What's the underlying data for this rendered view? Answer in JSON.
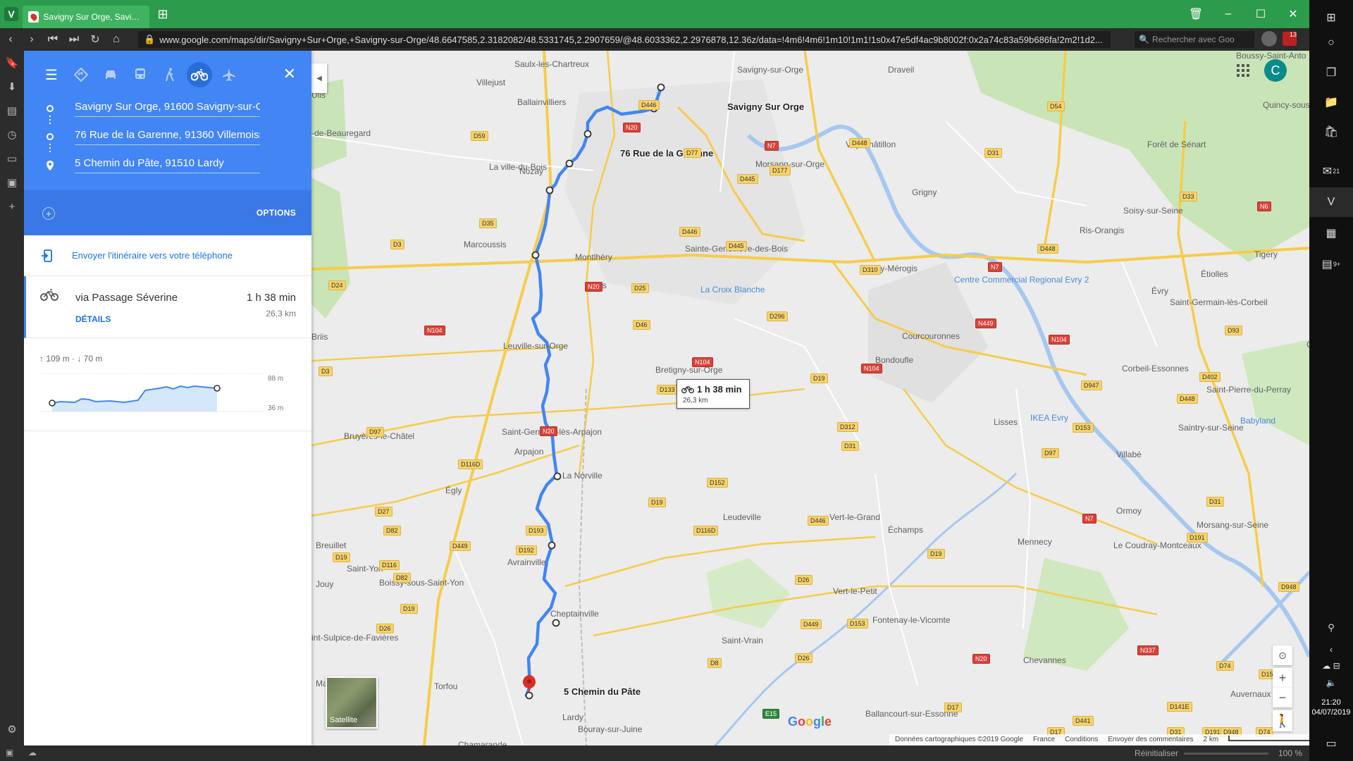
{
  "browser": {
    "tab_title": "Savigny Sur Orge, Savigny-",
    "url": "www.google.com/maps/dir/Savigny+Sur+Orge,+Savigny-sur-Orge/48.6647585,2.3182082/48.5331745,2.2907659/@48.6033362,2.2976878,12.36z/data=!4m6!4m6!1m10!1m1!1s0x47e5df4ac9b8002f:0x2a74c83a59b686fa!2m2!1d2...",
    "search_placeholder": "Rechercher avec Goo",
    "notif_badge": "13",
    "status_reset": "Réinitialiser",
    "status_zoom": "100 %"
  },
  "directions": {
    "waypoints": [
      "Savigny Sur Orge, 91600 Savigny-sur-Orge",
      "76 Rue de la Garenne, 91360 Villemoisson",
      "5 Chemin du Pâte, 91510 Lardy"
    ],
    "options_label": "OPTIONS",
    "send_label": "Envoyer l'itinéraire vers votre téléphone",
    "route": {
      "via": "via Passage Séverine",
      "duration": "1 h 38 min",
      "distance": "26,3 km",
      "details_label": "DÉTAILS"
    },
    "elevation": {
      "stats": "↑ 109 m · ↓ 70 m",
      "high": "88 m",
      "low": "36 m"
    }
  },
  "map": {
    "account_initial": "C",
    "route_label": {
      "duration": "1 h 38 min",
      "distance": "26,3 km"
    },
    "satellite_label": "Satellite",
    "google_logo": "Google",
    "attribution": [
      "Données cartographiques ©2019 Google",
      "France",
      "Conditions",
      "Envoyer des commentaires",
      "2 km"
    ],
    "stop_labels": {
      "start": "Savigny Sur Orge",
      "mid": "76 Rue de la Garenne",
      "end": "5 Chemin du Pâte"
    },
    "places": [
      {
        "t": "Saulx-les-Chartreux"
      },
      {
        "t": "Villejust"
      },
      {
        "t": "Ballainvilliers"
      },
      {
        "t": "Savigny-sur-Orge"
      },
      {
        "t": "Draveil"
      },
      {
        "t": "Boussy-Saint-Anto"
      },
      {
        "t": "Quincy-sous"
      },
      {
        "t": "Forêt de Sénart"
      },
      {
        "t": "Viry-Châtillon"
      },
      {
        "t": "Morsang-sur-Orge"
      },
      {
        "t": "La ville-du-Bois"
      },
      {
        "t": "Nozay"
      },
      {
        "t": "Grigny"
      },
      {
        "t": "Soisy-sur-Seine"
      },
      {
        "t": "Ris-Orangis"
      },
      {
        "t": "Marcoussis"
      },
      {
        "t": "Montlhéry"
      },
      {
        "t": "Sainte-Geneviève-des-Bois"
      },
      {
        "t": "Fleury-Mérogis"
      },
      {
        "t": "Tigery"
      },
      {
        "t": "Linas"
      },
      {
        "t": "La Croix Blanche"
      },
      {
        "t": "Centre Commercial Regional Evry 2"
      },
      {
        "t": "Évry"
      },
      {
        "t": "Étiolles"
      },
      {
        "t": "Saint-Germain-lès-Corbeil"
      },
      {
        "t": "Leuville-sur-Orge"
      },
      {
        "t": "Bretigny-sur-Orge"
      },
      {
        "t": "Courcouronnes"
      },
      {
        "t": "Bondoufle"
      },
      {
        "t": "Carré Séna"
      },
      {
        "t": "Corbeil-Essonnes"
      },
      {
        "t": "Saint-Pierre-du-Perray"
      },
      {
        "t": "Bruyères-le-Châtel"
      },
      {
        "t": "Saint-Germain-lès-Arpajon"
      },
      {
        "t": "Lisses"
      },
      {
        "t": "IKEA Evry"
      },
      {
        "t": "Saintry-sur-Seine"
      },
      {
        "t": "Babyland"
      },
      {
        "t": "Arpajon"
      },
      {
        "t": "La Norville"
      },
      {
        "t": "Villabé"
      },
      {
        "t": "Égly"
      },
      {
        "t": "Leudeville"
      },
      {
        "t": "Vert-le-Grand"
      },
      {
        "t": "Ormoy"
      },
      {
        "t": "Morsang-sur-Seine"
      },
      {
        "t": "Échamps"
      },
      {
        "t": "Breuillet"
      },
      {
        "t": "Mennecy"
      },
      {
        "t": "Le Coudray-Montceaux"
      },
      {
        "t": "Saint-Yon"
      },
      {
        "t": "Avrainville"
      },
      {
        "t": "Boissy-sous-Saint-Yon"
      },
      {
        "t": "Jouy"
      },
      {
        "t": "Vert-le-Petit"
      },
      {
        "t": "Cheptainville"
      },
      {
        "t": "Fontenay-le-Vicomte"
      },
      {
        "t": "Saint-Vrain"
      },
      {
        "t": "int-Sulpice-de-Favières"
      },
      {
        "t": "Chevannes"
      },
      {
        "t": "Mauchamps"
      },
      {
        "t": "Torfou"
      },
      {
        "t": "Auvernaux"
      },
      {
        "t": "Lardy"
      },
      {
        "t": "Bouray-sur-Juine"
      },
      {
        "t": "Ballancourt-sur-Essonne"
      },
      {
        "t": "Chamarande"
      },
      {
        "t": "Ulis"
      },
      {
        "t": "-de-Beauregard"
      },
      {
        "t": "Briis"
      }
    ],
    "roads": [
      "D446",
      "D59",
      "N20",
      "D77",
      "N7",
      "D177",
      "D448",
      "D31",
      "D54",
      "D445",
      "D35",
      "D446",
      "D3",
      "D445",
      "N6",
      "D33",
      "N7",
      "D448",
      "D24",
      "N20",
      "D25",
      "D310",
      "D46",
      "N104",
      "N449",
      "N104",
      "D93",
      "N104",
      "D296",
      "D3",
      "D19",
      "N104",
      "D133",
      "D402",
      "D448",
      "D947",
      "D97",
      "N20",
      "D312",
      "D31",
      "D153",
      "D97",
      "D116D",
      "D152",
      "D31",
      "D19",
      "D116D",
      "D446",
      "D27",
      "D82",
      "D193",
      "D449",
      "D192",
      "D116",
      "D19",
      "D19",
      "D26",
      "D153",
      "D82",
      "D19",
      "D26",
      "D26",
      "D191",
      "N7",
      "N337",
      "D449",
      "D8",
      "E15",
      "D31",
      "D153",
      "D948",
      "N20",
      "D17",
      "D17",
      "D141E",
      "D441",
      "D191",
      "D74",
      "D74",
      "D948"
    ]
  },
  "taskbar": {
    "clock_time": "21:20",
    "clock_date": "04/07/2019",
    "mail_badge": "21",
    "cal_badge": "9+"
  }
}
